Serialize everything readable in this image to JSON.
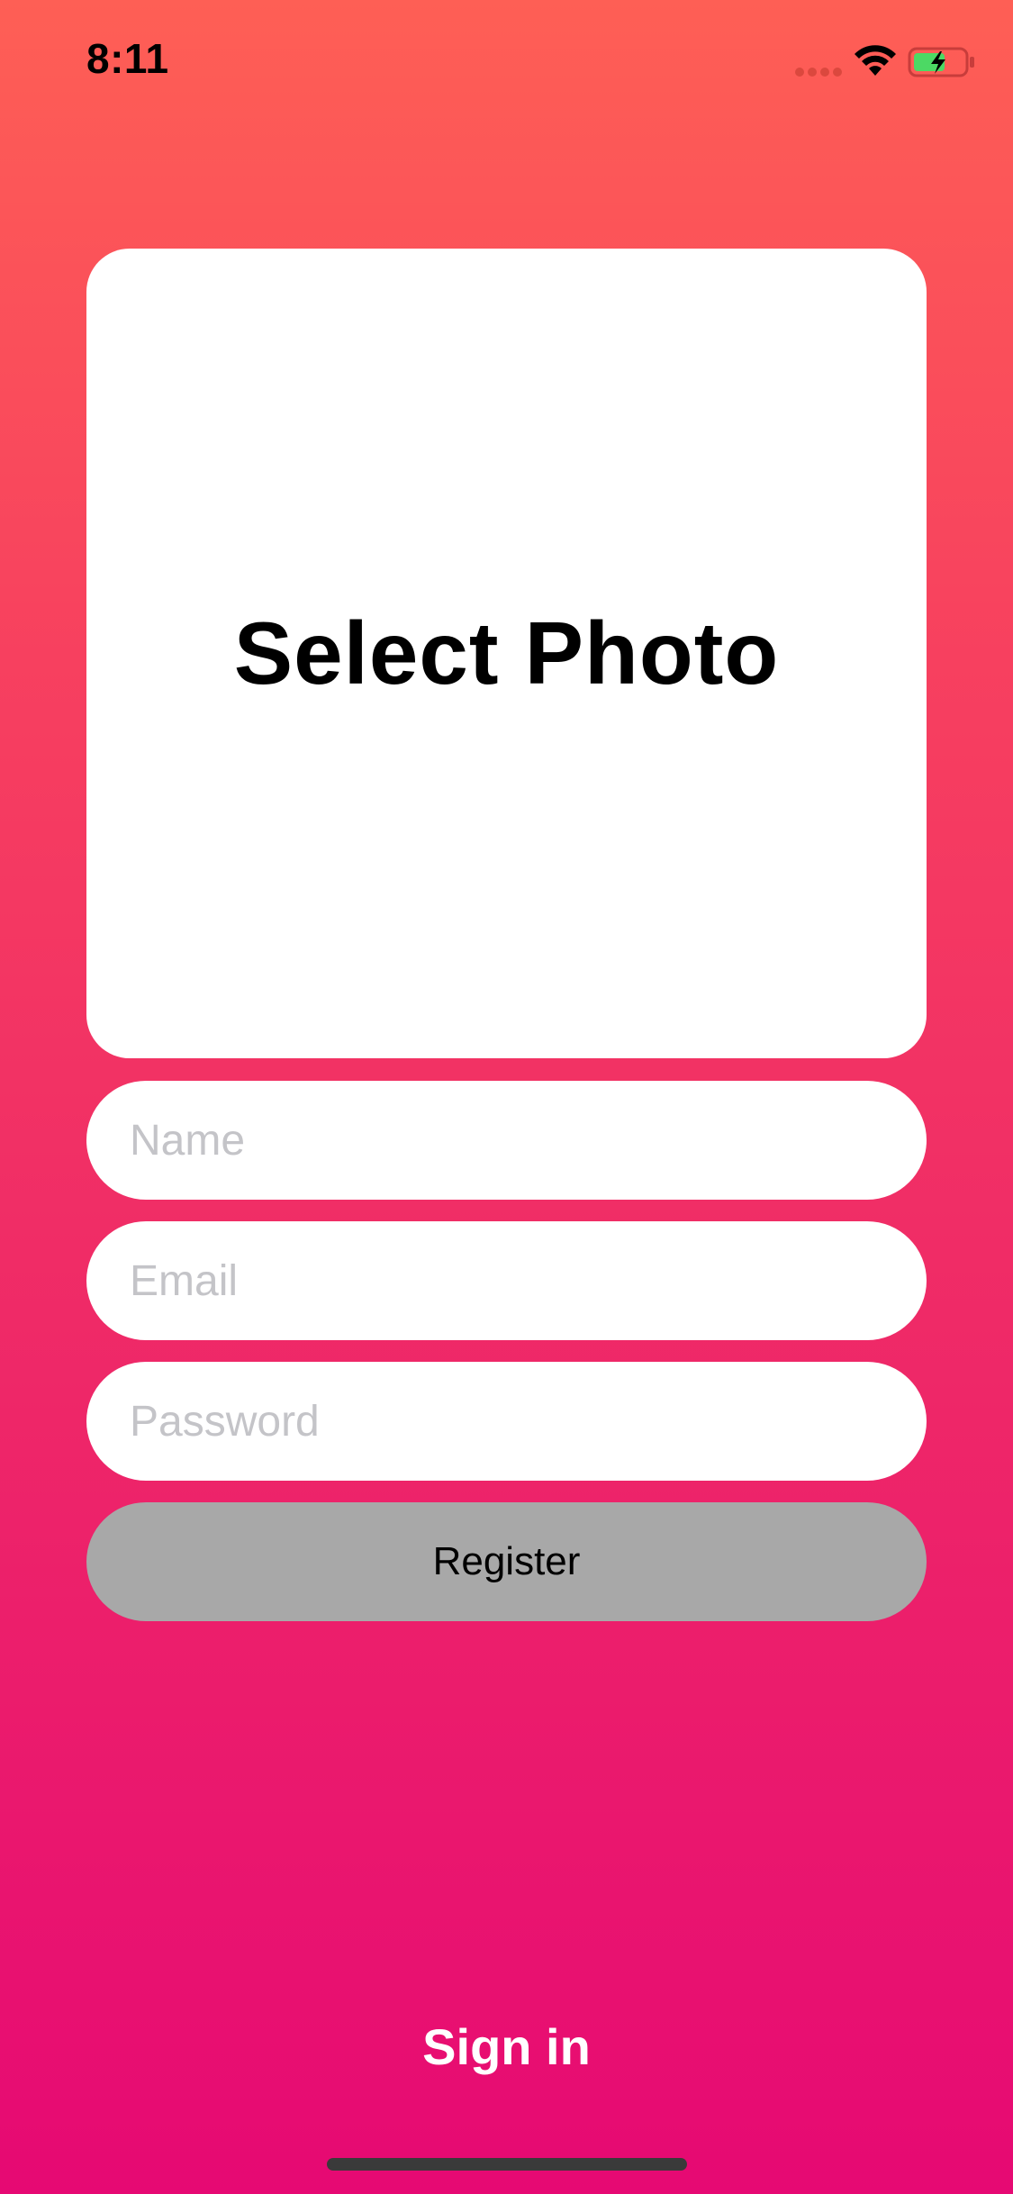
{
  "status_bar": {
    "time": "8:11",
    "icons": [
      "cellular-signal-icon",
      "wifi-icon",
      "battery-charging-icon"
    ]
  },
  "colors": {
    "gradient_top": "#fe5f55",
    "gradient_bottom": "#e60973",
    "card_background": "#ffffff",
    "register_button_background": "#a8a8a8",
    "placeholder_text": "#c4c4c8",
    "battery_fill": "#4cd964"
  },
  "photo_picker": {
    "label": "Select Photo"
  },
  "form": {
    "name_placeholder": "Name",
    "email_placeholder": "Email",
    "password_placeholder": "Password",
    "register_label": "Register"
  },
  "footer": {
    "signin_label": "Sign in"
  }
}
